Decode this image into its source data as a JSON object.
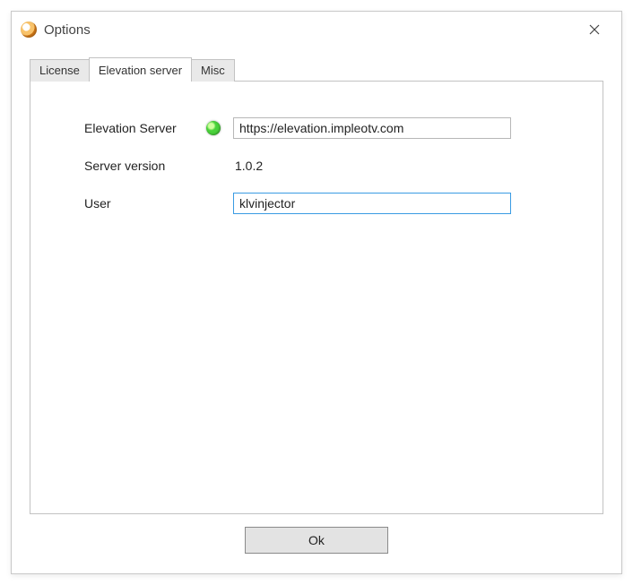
{
  "window": {
    "title": "Options"
  },
  "tabs": [
    {
      "label": "License"
    },
    {
      "label": "Elevation server"
    },
    {
      "label": "Misc"
    }
  ],
  "form": {
    "elevation_server_label": "Elevation Server",
    "elevation_server_value": "https://elevation.impleotv.com",
    "status_color": "#49d23a",
    "server_version_label": "Server version",
    "server_version_value": "1.0.2",
    "user_label": "User",
    "user_value": "klvinjector"
  },
  "footer": {
    "ok_label": "Ok"
  }
}
